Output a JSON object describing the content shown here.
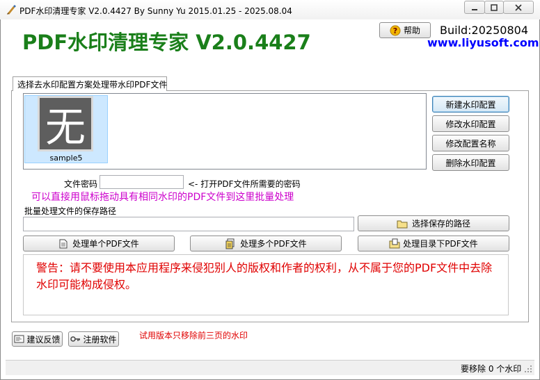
{
  "window": {
    "title": "PDF水印清理专家 V2.0.4427 By Sunny Yu 2015.01.25 - 2025.08.04",
    "minimize_icon": "minimize-icon",
    "maximize_icon": "maximize-icon",
    "close_icon": "close-icon"
  },
  "header": {
    "app_title": "PDF水印清理专家 V2.0.4427",
    "help_label": "帮助",
    "build": "Build:20250804",
    "website": "www.liyusoft.com"
  },
  "tab": {
    "label": "选择去水印配置方案处理带水印PDF文件"
  },
  "config_list": {
    "items": [
      {
        "label": "sample5",
        "glyph": "无",
        "selected": true
      }
    ]
  },
  "config_buttons": {
    "new_label": "新建水印配置",
    "edit_label": "修改水印配置",
    "rename_label": "修改配置名称",
    "delete_label": "删除水印配置"
  },
  "password": {
    "label": "文件密码",
    "value": "",
    "hint": "<- 打开PDF文件所需要的密码"
  },
  "drag_hint": "可以直接用鼠标拖动具有相同水印的PDF文件到这里批量处理",
  "save_path": {
    "label": "批量处理文件的保存路径",
    "value": "",
    "choose_label": "选择保存的路径"
  },
  "actions": {
    "single_label": "处理单个PDF文件",
    "multiple_label": "处理多个PDF文件",
    "folder_label": "处理目录下PDF文件"
  },
  "warning": "警告：请不要使用本应用程序来侵犯别人的版权和作者的权利，从不属于您的PDF文件中去除水印可能构成侵权。",
  "footer": {
    "feedback_label": "建议反馈",
    "register_label": "注册软件",
    "trial_note": "试用版本只移除前三页的水印"
  },
  "status": {
    "text": "要移除 0 个水印"
  },
  "colors": {
    "title_green": "#1a7f1a",
    "link_blue": "#0000ff",
    "hint_magenta": "#cc00cc",
    "warning_red": "#e00000",
    "selection_blue": "#cde8ff"
  }
}
